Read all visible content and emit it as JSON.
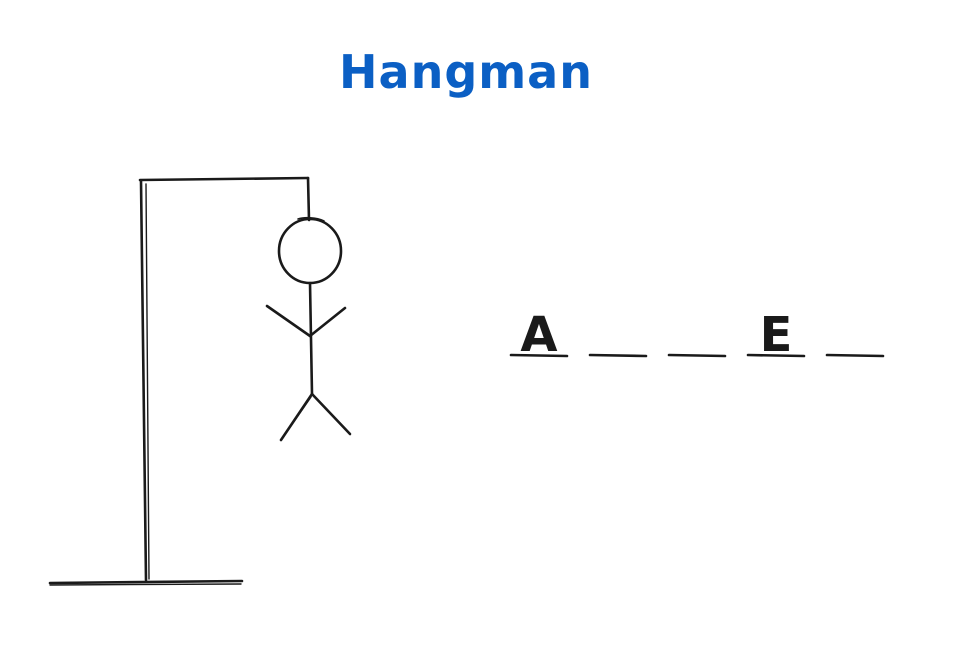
{
  "title": "Hangman",
  "colors": {
    "title": "#0b5fc4",
    "ink": "#1a1a1a"
  },
  "word": [
    {
      "letter": "A",
      "revealed": true
    },
    {
      "letter": "",
      "revealed": false
    },
    {
      "letter": "",
      "revealed": false
    },
    {
      "letter": "E",
      "revealed": true
    },
    {
      "letter": "",
      "revealed": false
    }
  ],
  "figure_parts": [
    "head",
    "torso",
    "left-arm",
    "right-arm",
    "left-leg",
    "right-leg"
  ]
}
